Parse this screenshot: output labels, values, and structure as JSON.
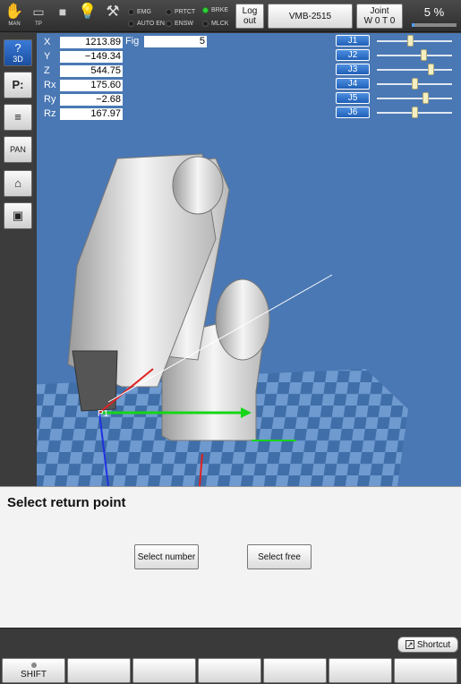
{
  "toolbar": {
    "icons": [
      {
        "name": "hand-icon",
        "caption": "MAN"
      },
      {
        "name": "teach-pendant-icon",
        "caption": "TP"
      },
      {
        "name": "stop-icon",
        "caption": ""
      },
      {
        "name": "lightbulb-icon",
        "caption": ""
      },
      {
        "name": "wrench-icon",
        "caption": ""
      }
    ],
    "lamps": [
      {
        "label": "EMG",
        "on": false
      },
      {
        "label": "AUTO EN",
        "on": false
      },
      {
        "label": "PRTCT",
        "on": false
      },
      {
        "label": "ENSW",
        "on": false
      },
      {
        "label": "BRKE",
        "on": true
      },
      {
        "label": "MLCK",
        "on": false
      }
    ],
    "logout_line1": "Log",
    "logout_line2": "out",
    "robot_model": "VMB-2515",
    "joint_line1": "Joint",
    "joint_line2": "W 0 T 0",
    "speed_label": "5 %",
    "speed_fraction": 0.05
  },
  "leftbar": {
    "buttons": [
      {
        "name": "3d-view-button",
        "icon": "?",
        "label": "3D",
        "active": true
      },
      {
        "name": "point-button",
        "icon": "P:",
        "label": "",
        "active": false
      },
      {
        "name": "layer-button",
        "icon": "≡",
        "label": "",
        "active": false
      },
      {
        "name": "pan-button",
        "icon": "",
        "label": "PAN",
        "active": false
      },
      {
        "name": "home-view-button",
        "icon": "⌂",
        "label": "",
        "active": false
      },
      {
        "name": "cube-view-button",
        "icon": "▣",
        "label": "",
        "active": false
      }
    ]
  },
  "coords": [
    {
      "label": "X",
      "value": "1213.89"
    },
    {
      "label": "Y",
      "value": "−149.34"
    },
    {
      "label": "Z",
      "value": "544.75"
    },
    {
      "label": "Rx",
      "value": "175.60"
    },
    {
      "label": "Ry",
      "value": "−2.68"
    },
    {
      "label": "Rz",
      "value": "167.97"
    }
  ],
  "fig": {
    "label": "Fig",
    "value": "5"
  },
  "joints": [
    {
      "label": "J1",
      "level": 0.44
    },
    {
      "label": "J2",
      "level": 0.62
    },
    {
      "label": "J3",
      "level": 0.72
    },
    {
      "label": "J4",
      "level": 0.5
    },
    {
      "label": "J5",
      "level": 0.64
    },
    {
      "label": "J6",
      "level": 0.5
    }
  ],
  "scene": {
    "point_label": "P1"
  },
  "panel": {
    "title": "Select return point",
    "select_number": "Select number",
    "select_free": "Select free"
  },
  "bottombar": {
    "shortcut_label": "Shortcut",
    "shift_label": "SHIFT",
    "function_keys": [
      "",
      "",
      "",
      "",
      "",
      ""
    ]
  }
}
